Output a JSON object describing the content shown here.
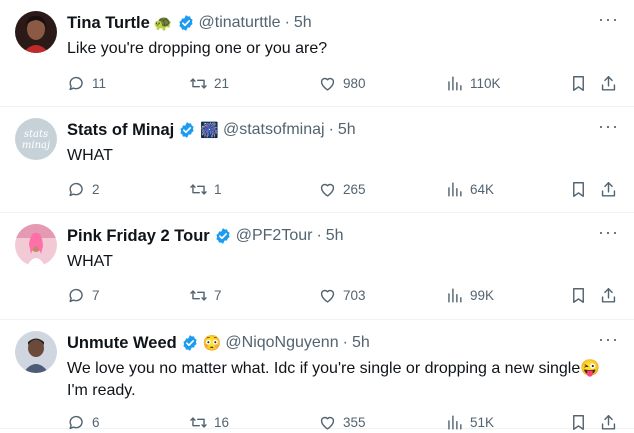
{
  "tweets": [
    {
      "name": "Tina Turtle",
      "name_emoji": "🐢",
      "handle": "@tinaturttle",
      "time": "5h",
      "text": "Like you're dropping one or you are?",
      "replies": "11",
      "retweets": "21",
      "likes": "980",
      "views": "110K",
      "avatar_color": "#5a2f2f"
    },
    {
      "name": "Stats of Minaj",
      "name_emoji": "🎆",
      "handle": "@statsofminaj",
      "time": "5h",
      "text": "WHAT",
      "replies": "2",
      "retweets": "1",
      "likes": "265",
      "views": "64K",
      "avatar_text": "stats\nminaj",
      "avatar_color": "#c7d2d8"
    },
    {
      "name": "Pink Friday 2 Tour",
      "name_emoji": "",
      "handle": "@PF2Tour",
      "time": "5h",
      "text": "WHAT",
      "replies": "7",
      "retweets": "7",
      "likes": "703",
      "views": "99K",
      "avatar_color": "#e8b8c6"
    },
    {
      "name": "Unmute Weed",
      "name_emoji": "😳",
      "handle": "@NiqoNguyenn",
      "time": "5h",
      "text": "We love you no matter what. Idc if you're  single or dropping a new single😜\nI'm ready.",
      "replies": "6",
      "retweets": "16",
      "likes": "355",
      "views": "51K",
      "avatar_color": "#7d8ba0"
    }
  ],
  "colors": {
    "verified": "#1d9bf0",
    "secondary_text": "#536471",
    "divider": "#eff3f4"
  },
  "icons": [
    "reply-icon",
    "retweet-icon",
    "like-icon",
    "views-icon",
    "bookmark-icon",
    "share-icon",
    "more-icon",
    "verified-badge-icon"
  ]
}
